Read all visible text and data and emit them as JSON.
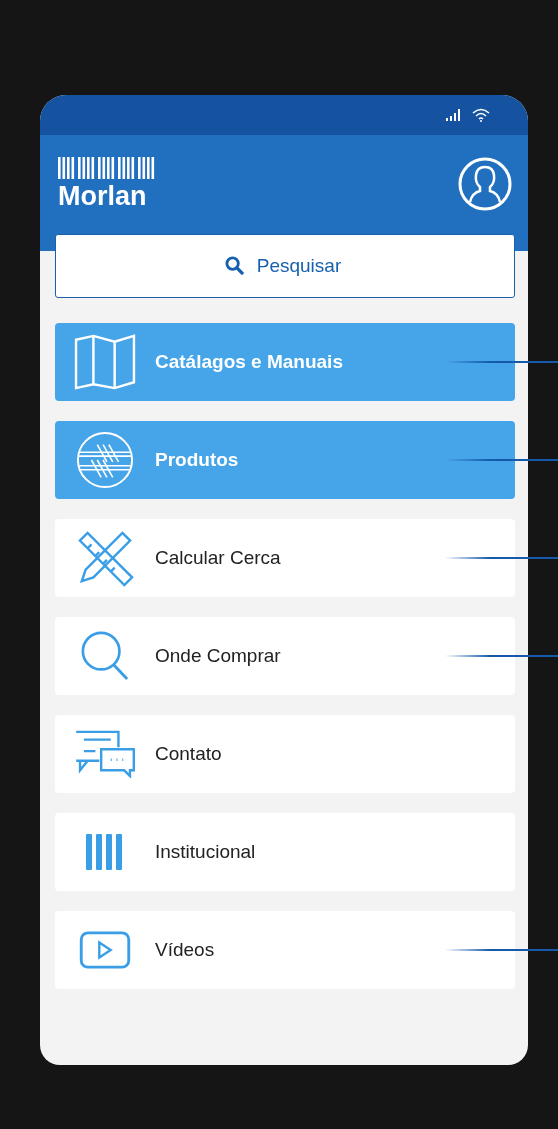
{
  "header": {
    "logo": "Morlan"
  },
  "search": {
    "placeholder": "Pesquisar"
  },
  "menu": [
    {
      "label": "Catálagos e Manuais",
      "selected": true,
      "leader": true
    },
    {
      "label": "Produtos",
      "selected": true,
      "leader": true
    },
    {
      "label": "Calcular Cerca",
      "selected": false,
      "leader": true
    },
    {
      "label": "Onde Comprar",
      "selected": false,
      "leader": true
    },
    {
      "label": "Contato",
      "selected": false,
      "leader": false
    },
    {
      "label": "Institucional",
      "selected": false,
      "leader": false
    },
    {
      "label": "Vídeos",
      "selected": false,
      "leader": true
    }
  ]
}
